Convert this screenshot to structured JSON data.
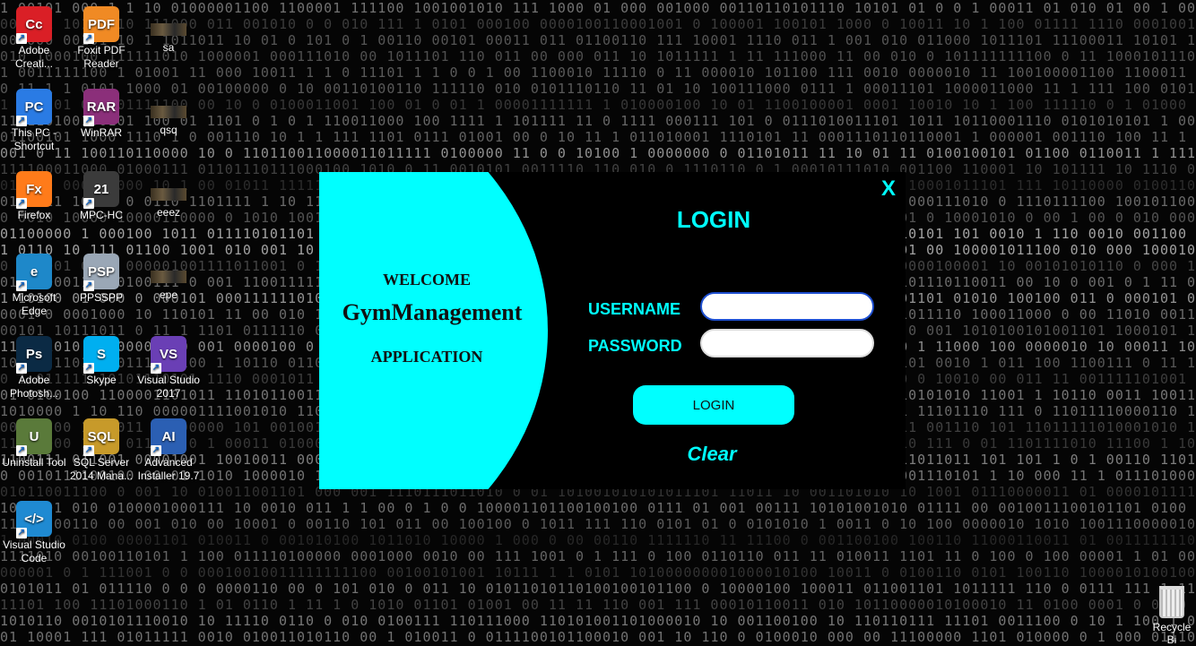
{
  "desktop": {
    "icons": [
      {
        "label": "Adobe Creati...",
        "icon": "adobe-creative-cloud-icon",
        "color": "#da1f26",
        "glyph": "Cc"
      },
      {
        "label": "Foxit PDF Reader",
        "icon": "foxit-pdf-icon",
        "color": "#f08a24",
        "glyph": "PDF"
      },
      {
        "label": "sa",
        "icon": "video-file-icon"
      },
      {
        "label": "This PC - Shortcut",
        "icon": "this-pc-icon",
        "color": "#2a7be4",
        "glyph": "PC"
      },
      {
        "label": "WinRAR",
        "icon": "winrar-icon",
        "color": "#8b2f7a",
        "glyph": "RAR"
      },
      {
        "label": "qsq",
        "icon": "video-file-icon"
      },
      {
        "label": "Firefox",
        "icon": "firefox-icon",
        "color": "#ff7b1a",
        "glyph": "Fx"
      },
      {
        "label": "MPC-HC",
        "icon": "mpc-hc-icon",
        "color": "#3b3b3b",
        "glyph": "21"
      },
      {
        "label": "eeez",
        "icon": "video-file-icon"
      },
      {
        "label": "Microsoft Edge",
        "icon": "edge-icon",
        "color": "#1e88c9",
        "glyph": "e"
      },
      {
        "label": "PPSSPP",
        "icon": "ppsspp-icon",
        "color": "#9aa7b6",
        "glyph": "PSP"
      },
      {
        "label": "epe",
        "icon": "video-file-icon"
      },
      {
        "label": "Adobe Photosh...",
        "icon": "photoshop-icon",
        "color": "#0b2a44",
        "glyph": "Ps"
      },
      {
        "label": "Skype",
        "icon": "skype-icon",
        "color": "#00aff0",
        "glyph": "S"
      },
      {
        "label": "Visual Studio 2017",
        "icon": "visual-studio-icon",
        "color": "#6a3fb5",
        "glyph": "VS"
      },
      {
        "label": "Uninstall Tool",
        "icon": "uninstall-tool-icon",
        "color": "#5a7a3a",
        "glyph": "U"
      },
      {
        "label": "SQL Server 2014 Mana...",
        "icon": "sql-server-icon",
        "color": "#c79a2a",
        "glyph": "SQL"
      },
      {
        "label": "Advanced Installer 19.7",
        "icon": "advanced-installer-icon",
        "color": "#2b5fb3",
        "glyph": "AI"
      },
      {
        "label": "Visual Studio Code",
        "icon": "vscode-icon",
        "color": "#1f8ad2",
        "glyph": "&lt;/&gt;"
      }
    ],
    "recycle_bin": {
      "label": "Recycle Bi",
      "icon": "recycle-bin-icon"
    }
  },
  "login_window": {
    "close_label": "X",
    "welcome_line1": "WELCOME",
    "welcome_line2": "GymManagement",
    "welcome_line3": "APPLICATION",
    "title": "LOGIN",
    "username_label": "USERNAME",
    "password_label": "PASSWORD",
    "username_value": "",
    "password_value": "",
    "login_button": "LOGIN",
    "clear_link": "Clear"
  },
  "colors": {
    "accent": "#00ffff",
    "window_bg": "#000000"
  }
}
